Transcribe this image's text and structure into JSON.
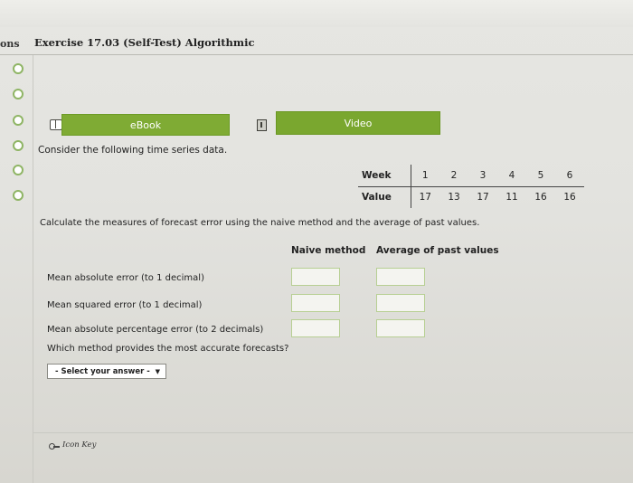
{
  "header": {
    "nav_partial": "ons",
    "title": "Exercise 17.03 (Self-Test) Algorithmic"
  },
  "resources": {
    "ebook_label": "eBook",
    "video_label": "Video"
  },
  "problem": {
    "prompt": "Consider the following time series data.",
    "table": {
      "week_label": "Week",
      "value_label": "Value",
      "weeks": [
        "1",
        "2",
        "3",
        "4",
        "5",
        "6"
      ],
      "values": [
        "17",
        "13",
        "17",
        "11",
        "16",
        "16"
      ]
    },
    "question": "Calculate the measures of forecast error using the naive method and the average of past values."
  },
  "answers": {
    "col_naive": "Naive method",
    "col_average": "Average of past values",
    "rows": [
      {
        "label": "Mean absolute error (to 1 decimal)"
      },
      {
        "label": "Mean squared error (to 1 decimal)"
      },
      {
        "label": "Mean absolute percentage error (to 2 decimals)"
      }
    ],
    "accuracy_question": "Which method provides the most accurate forecasts?",
    "select_value": "- Select your answer -"
  },
  "footer": {
    "icon_key": "Icon Key"
  },
  "colors": {
    "button_green": "#7fab34",
    "radio_green": "#8fb565"
  }
}
